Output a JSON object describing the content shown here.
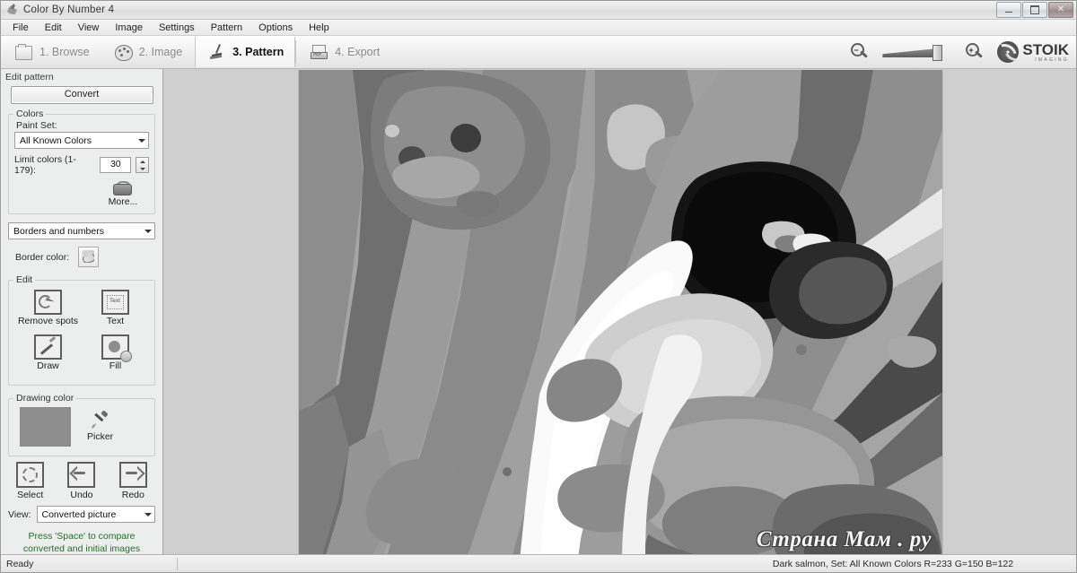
{
  "window": {
    "title": "Color By Number 4",
    "icon": "app-icon",
    "controls": {
      "minimize": "–",
      "maximize": "❐",
      "close": "✕"
    }
  },
  "menubar": {
    "items": [
      "File",
      "Edit",
      "View",
      "Image",
      "Settings",
      "Pattern",
      "Options",
      "Help"
    ]
  },
  "wizard": {
    "tabs": [
      {
        "label": "1. Browse",
        "icon": "folder-icon",
        "active": false
      },
      {
        "label": "2. Image",
        "icon": "palette-icon",
        "active": false
      },
      {
        "label": "3. Pattern",
        "icon": "brush-icon",
        "active": true
      },
      {
        "label": "4. Export",
        "icon": "export-icon",
        "active": false
      }
    ],
    "toolbar_right": {
      "zoom_out": "zoom-out-icon",
      "zoom_slider": "zoom-slider",
      "zoom_in": "zoom-in-icon",
      "logo_name": "STOIK",
      "logo_sub": "IMAGING"
    }
  },
  "sidebar": {
    "header": "Edit pattern",
    "convert_label": "Convert",
    "colors_group": {
      "legend": "Colors",
      "paint_set_label": "Paint Set:",
      "paint_set_value": "All Known Colors",
      "limit_label": "Limit colors (1-179):",
      "limit_value": "30",
      "more_label": "More...",
      "more_icon": "paint-can-icon"
    },
    "borders_combo": "Borders and numbers",
    "border_color_label": "Border color:",
    "border_color_icon": "border-color-swatch-icon",
    "edit_group": {
      "legend": "Edit",
      "tools": [
        {
          "label": "Remove spots",
          "icon": "remove-spots-icon"
        },
        {
          "label": "Text",
          "icon": "text-icon"
        },
        {
          "label": "Draw",
          "icon": "draw-icon"
        },
        {
          "label": "Fill",
          "icon": "fill-icon"
        }
      ]
    },
    "drawing_color_group": {
      "legend": "Drawing color",
      "swatch_color": "#8e8e8e",
      "picker_label": "Picker",
      "picker_icon": "eyedropper-icon"
    },
    "actions": [
      {
        "label": "Select",
        "icon": "select-icon"
      },
      {
        "label": "Undo",
        "icon": "undo-icon"
      },
      {
        "label": "Redo",
        "icon": "redo-icon"
      }
    ],
    "view_label": "View:",
    "view_value": "Converted picture",
    "hint": "Press 'Space' to compare converted and initial images"
  },
  "canvas": {
    "watermark": "Страна Мам . ру"
  },
  "statusbar": {
    "left": "Ready",
    "right": "Dark salmon,  Set: All Known Colors R=233 G=150 B=122"
  }
}
